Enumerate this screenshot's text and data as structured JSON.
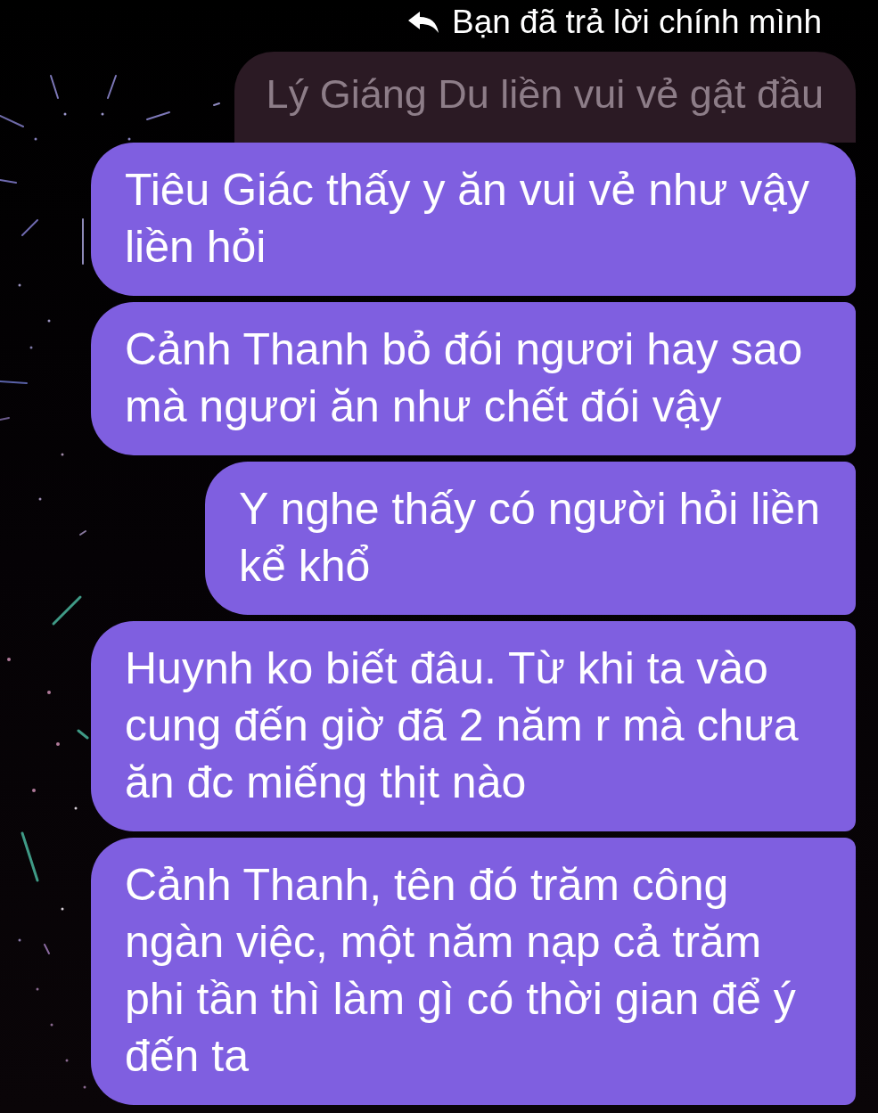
{
  "reply_header": {
    "text": "Bạn đã trả lời chính mình"
  },
  "quoted_message": {
    "text": "Lý Giáng Du liền vui vẻ gật đầu"
  },
  "messages": [
    {
      "text": "Tiêu Giác thấy y ăn vui vẻ như vậy liền hỏi"
    },
    {
      "text": "Cảnh Thanh bỏ đói ngươi hay sao mà ngươi ăn như chết đói vậy"
    },
    {
      "text": "Y nghe thấy có người hỏi liền\nkể khổ"
    },
    {
      "text": "Huynh ko biết đâu. Từ khi ta vào cung đến giờ đã 2 năm r mà chưa ăn đc miếng thịt nào"
    },
    {
      "text": "Cảnh Thanh, tên đó trăm công ngàn việc, một năm nạp cả trăm phi tần thì làm gì có thời gian để ý đến ta"
    }
  ]
}
